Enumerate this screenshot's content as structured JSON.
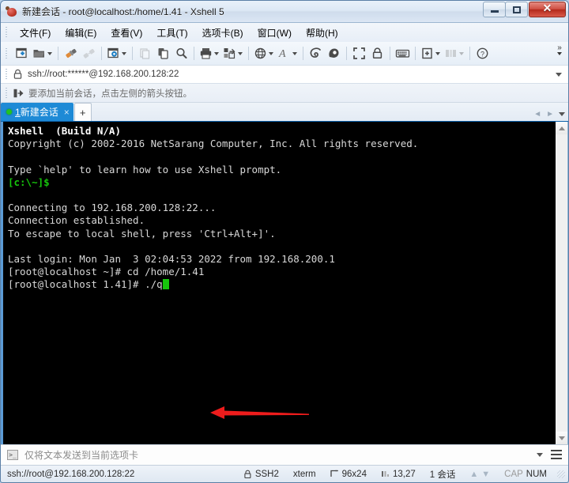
{
  "window": {
    "title": "新建会话 - root@localhost:/home/1.41 - Xshell 5",
    "ghost_title": "",
    "icon": "xshell-logo-icon",
    "buttons": {
      "minimize": "minimize-button",
      "maximize": "maximize-button",
      "close": "close-button"
    }
  },
  "menubar": {
    "items": [
      {
        "label": "文件(F)"
      },
      {
        "label": "编辑(E)"
      },
      {
        "label": "查看(V)"
      },
      {
        "label": "工具(T)"
      },
      {
        "label": "选项卡(B)"
      },
      {
        "label": "窗口(W)"
      },
      {
        "label": "帮助(H)"
      }
    ]
  },
  "toolbar": {
    "overflow_label": "»",
    "buttons": [
      {
        "name": "new-session-icon",
        "disabled": false,
        "dropdown": false
      },
      {
        "name": "open-folder-icon",
        "disabled": false,
        "dropdown": true
      },
      {
        "name": "connect-icon",
        "disabled": false,
        "dropdown": false
      },
      {
        "name": "disconnect-icon",
        "disabled": true,
        "dropdown": false
      },
      {
        "name": "session-properties-icon",
        "disabled": false,
        "dropdown": true
      },
      {
        "name": "cut-icon",
        "disabled": true,
        "dropdown": false
      },
      {
        "name": "copy-paste-icon",
        "disabled": false,
        "dropdown": false
      },
      {
        "name": "find-icon",
        "disabled": false,
        "dropdown": false
      },
      {
        "name": "print-icon",
        "disabled": false,
        "dropdown": true
      },
      {
        "name": "file-transfer-icon",
        "disabled": false,
        "dropdown": true
      },
      {
        "name": "globe-icon",
        "disabled": false,
        "dropdown": true
      },
      {
        "name": "font-icon",
        "disabled": false,
        "dropdown": true
      },
      {
        "name": "log-icon",
        "disabled": false,
        "dropdown": false
      },
      {
        "name": "highlight-icon",
        "disabled": false,
        "dropdown": false
      },
      {
        "name": "fullscreen-icon",
        "disabled": false,
        "dropdown": false
      },
      {
        "name": "lock-icon",
        "disabled": false,
        "dropdown": false
      },
      {
        "name": "keyboard-icon",
        "disabled": false,
        "dropdown": false
      },
      {
        "name": "add-tab-icon",
        "disabled": false,
        "dropdown": true
      },
      {
        "name": "arrange-panes-icon",
        "disabled": true,
        "dropdown": true
      },
      {
        "name": "help-icon",
        "disabled": false,
        "dropdown": false
      }
    ]
  },
  "address_bar": {
    "icon": "lock-icon",
    "value": "ssh://root:******@192.168.200.128:22"
  },
  "hint_bar": {
    "icon": "add-to-favorites-icon",
    "text": "要添加当前会话，点击左侧的箭头按钮。"
  },
  "tabs": {
    "active": {
      "index": "1",
      "label": "新建会话",
      "close": "×",
      "status_dot_color": "#22c322"
    },
    "new_tab_label": "+",
    "nav_prev": "◄",
    "nav_next": "►"
  },
  "terminal": {
    "lines": [
      [
        {
          "t": "Xshell  (Build N/A)",
          "c": "t-bold"
        }
      ],
      [
        {
          "t": "Copyright (c) 2002-2016 NetSarang Computer, Inc. All rights reserved.",
          "c": "t-white"
        }
      ],
      [
        {
          "t": "",
          "c": "t-white"
        }
      ],
      [
        {
          "t": "Type `help' to learn how to use Xshell prompt.",
          "c": "t-white"
        }
      ],
      [
        {
          "t": "[c:\\~]$",
          "c": "t-green"
        }
      ],
      [
        {
          "t": "",
          "c": "t-white"
        }
      ],
      [
        {
          "t": "Connecting to 192.168.200.128:22...",
          "c": "t-white"
        }
      ],
      [
        {
          "t": "Connection established.",
          "c": "t-white"
        }
      ],
      [
        {
          "t": "To escape to local shell, press 'Ctrl+Alt+]'.",
          "c": "t-white"
        }
      ],
      [
        {
          "t": "",
          "c": "t-white"
        }
      ],
      [
        {
          "t": "Last login: Mon Jan  3 02:04:53 2022 from 192.168.200.1",
          "c": "t-white"
        }
      ],
      [
        {
          "t": "[root@localhost ~]# cd /home/1.41",
          "c": "t-white"
        }
      ],
      [
        {
          "t": "[root@localhost 1.41]# ./q",
          "c": "t-white"
        },
        {
          "t": "",
          "c": "cursor"
        }
      ]
    ],
    "annotation": {
      "name": "red-arrow-annotation",
      "color": "#ee1c1c",
      "direction": "left"
    },
    "scrollbar": {
      "up": "scroll-up-arrow",
      "down": "scroll-down-arrow"
    }
  },
  "send_bar": {
    "icon": "command-prompt-icon",
    "placeholder": "仅将文本发送到当前选项卡",
    "value": ""
  },
  "status_bar": {
    "connection": "ssh://root@192.168.200.128:22",
    "protocol": "SSH2",
    "terminal_type": "xterm",
    "size": "96x24",
    "cursor_pos": "13,27",
    "sessions": "1 会话",
    "cap": "CAP",
    "num": "NUM"
  }
}
